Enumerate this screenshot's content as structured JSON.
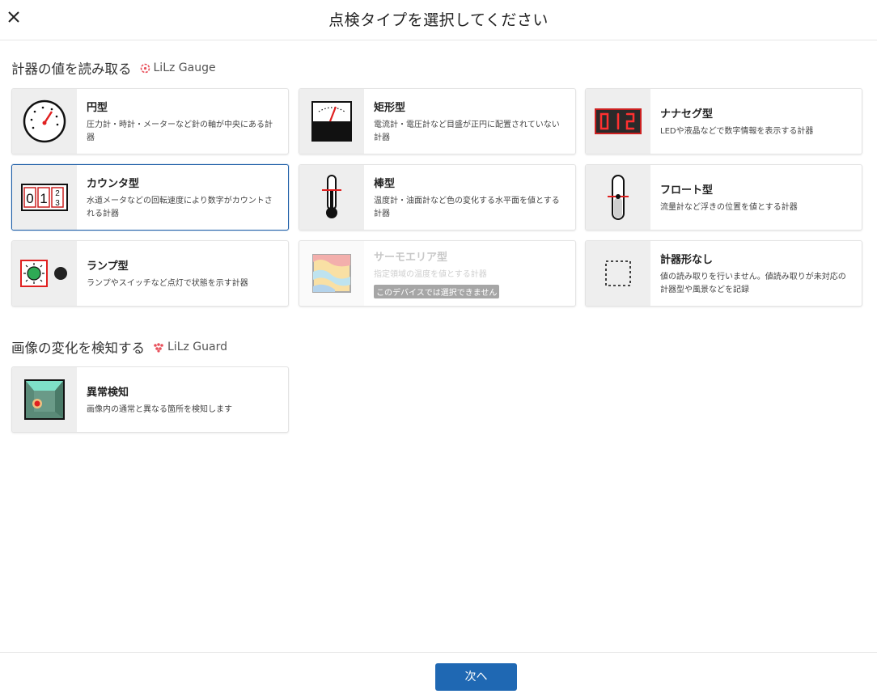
{
  "header": {
    "title": "点検タイプを選択してください"
  },
  "sections": {
    "gauge": {
      "title": "計器の値を読み取る",
      "brand": "LiLz Gauge",
      "brand_color": "#e8505b"
    },
    "guard": {
      "title": "画像の変化を検知する",
      "brand": "LiLz Guard",
      "brand_color": "#e8505b"
    }
  },
  "cards": {
    "circle": {
      "name": "円型",
      "desc": "圧力計・時計・メーターなど針の軸が中央にある計器",
      "icon": "round-dial-gauge-icon"
    },
    "rect": {
      "name": "矩形型",
      "desc": "電流計・電圧計など目盛が正円に配置されていない計器",
      "icon": "rectangular-meter-icon"
    },
    "seven": {
      "name": "ナナセグ型",
      "desc": "LEDや液晶などで数字情報を表示する計器",
      "icon": "seven-segment-display-icon"
    },
    "counter": {
      "name": "カウンタ型",
      "desc": "水道メータなどの回転速度により数字がカウントされる計器",
      "icon": "counter-icon",
      "selected": true
    },
    "bar": {
      "name": "棒型",
      "desc": "温度計・油面計など色の変化する水平面を値とする計器",
      "icon": "thermometer-icon"
    },
    "float": {
      "name": "フロート型",
      "desc": "流量計など浮きの位置を値とする計器",
      "icon": "float-gauge-icon"
    },
    "lamp": {
      "name": "ランプ型",
      "desc": "ランプやスイッチなど点灯で状態を示す計器",
      "icon": "lamp-icon"
    },
    "thermo": {
      "name": "サーモエリア型",
      "desc": "指定領域の温度を値とする計器",
      "badge": "このデバイスでは選択できません",
      "icon": "thermal-area-icon",
      "disabled": true
    },
    "none": {
      "name": "計器形なし",
      "desc": "値の読み取りを行いません。値読み取りが未対応の計器型や風景などを記録",
      "icon": "dashed-box-icon"
    },
    "anomaly": {
      "name": "異常検知",
      "desc": "画像内の通常と異なる箇所を検知します",
      "icon": "anomaly-detection-icon"
    }
  },
  "footer": {
    "next_label": "次へ"
  },
  "colors": {
    "accent": "#1f68b3",
    "red": "#e02020"
  }
}
